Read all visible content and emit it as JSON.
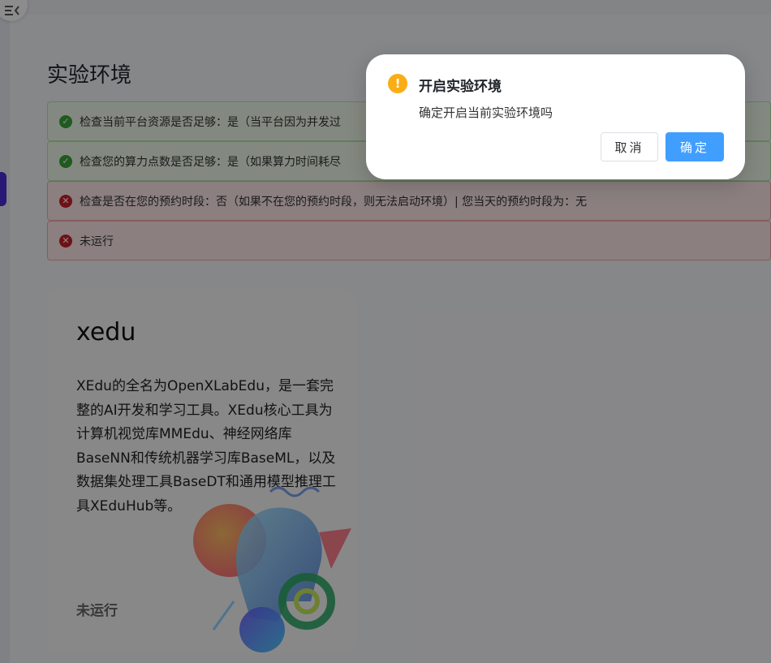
{
  "page": {
    "title": "实验环境"
  },
  "alerts": [
    {
      "type": "success",
      "text": "检查当前平台资源是否足够：是（当平台因为并发过"
    },
    {
      "type": "success",
      "text": "检查您的算力点数是否足够：是（如果算力时间耗尽"
    },
    {
      "type": "error",
      "text": "检查是否在您的预约时段：否（如果不在您的预约时段，则无法启动环境）| 您当天的预约时段为：无"
    },
    {
      "type": "error",
      "text": "未运行"
    }
  ],
  "card": {
    "title": "xedu",
    "description": "XEdu的全名为OpenXLabEdu，是一套完整的AI开发和学习工具。XEdu核心工具为计算机视觉库MMEdu、神经网络库BaseNN和传统机器学习库BaseML，以及数据集处理工具BaseDT和通用模型推理工具XEduHub等。",
    "status": "未运行"
  },
  "dialog": {
    "title": "开启实验环境",
    "message": "确定开启当前实验环境吗",
    "cancel_label": "取消",
    "ok_label": "确定",
    "warning_icon": "!"
  },
  "colors": {
    "primary": "#409eff",
    "warning": "#faad14",
    "success": "#3aa43a",
    "error": "#c8202b",
    "side_tab": "#4a2bd3"
  },
  "icons": {
    "toggle": "menu-collapse-icon",
    "success": "check-circle-icon",
    "error": "close-circle-icon",
    "warning": "exclamation-circle-icon"
  }
}
